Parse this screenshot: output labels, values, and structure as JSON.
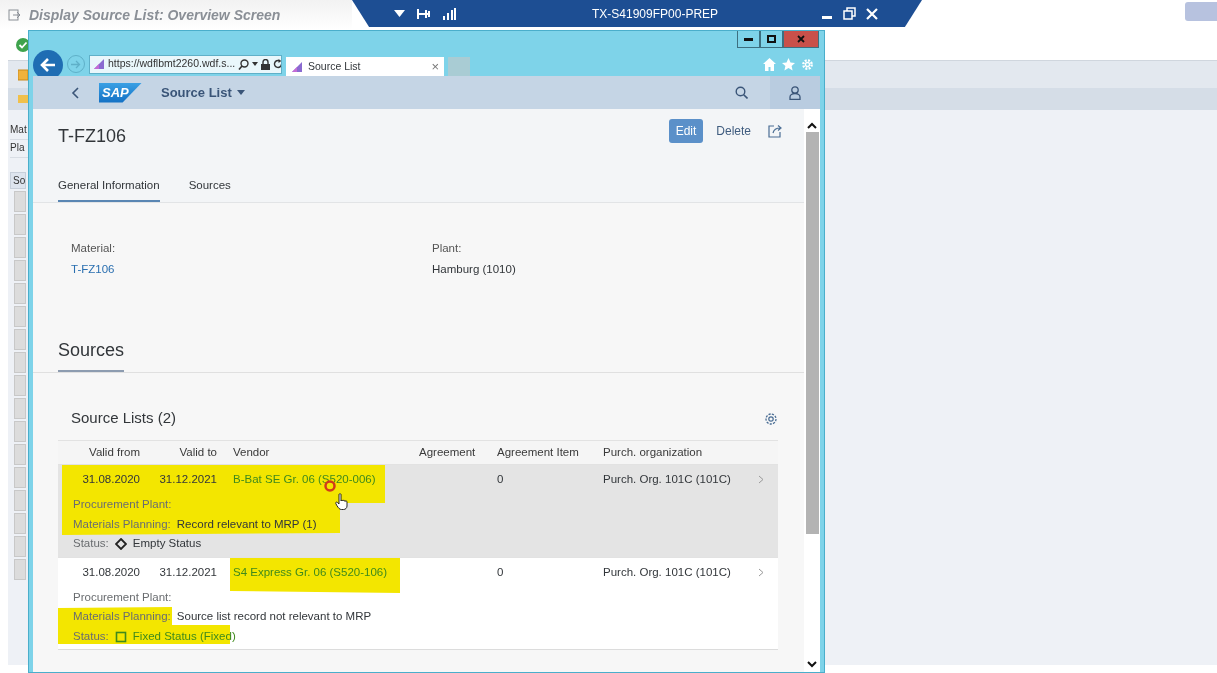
{
  "background_app": {
    "title": "Display Source List: Overview Screen",
    "connection": "TX-S41909FP00-PREP",
    "field_labels": [
      "Mat",
      "Pla"
    ],
    "tab_label": "So"
  },
  "browser": {
    "address": "https://wdflbmt2260.wdf.s...",
    "tab_title": "Source List",
    "tab_close": "×"
  },
  "shell": {
    "logo": "SAP",
    "app_title": "Source List"
  },
  "object": {
    "title": "T-FZ106",
    "actions": [
      {
        "label": "Edit",
        "kind": "primary"
      },
      {
        "label": "Delete",
        "kind": "text"
      }
    ]
  },
  "tabs": [
    {
      "label": "General Information",
      "selected": true
    },
    {
      "label": "Sources",
      "selected": false
    }
  ],
  "general_information": {
    "fields": [
      {
        "label": "Material:",
        "value": "T-FZ106",
        "kind": "link"
      },
      {
        "label": "Plant:",
        "value": "Hamburg (1010)",
        "kind": "text"
      }
    ]
  },
  "section": {
    "title": "Sources"
  },
  "source_lists": {
    "title": "Source Lists (2)",
    "columns": [
      "Valid from",
      "Valid to",
      "Vendor",
      "Agreement",
      "Agreement Item",
      "Purch. organization"
    ],
    "rows": [
      {
        "valid_from": "31.08.2020",
        "valid_to": "31.12.2021",
        "vendor": "B-Bat SE Gr. 06 (S520-006)",
        "agreement_item": "0",
        "purch_org": "Purch. Org. 101C (101C)",
        "procurement_plant_label": "Procurement Plant:",
        "materials_planning_label": "Materials Planning:",
        "materials_planning": "Record relevant to MRP (1)",
        "status_label": "Status:",
        "status": {
          "text": "Empty Status",
          "kind": "empty"
        },
        "hovered": true
      },
      {
        "valid_from": "31.08.2020",
        "valid_to": "31.12.2021",
        "vendor": "S4 Express Gr. 06 (S520-106)",
        "agreement_item": "0",
        "purch_org": "Purch. Org. 101C (101C)",
        "procurement_plant_label": "Procurement Plant:",
        "materials_planning_label": "Materials Planning:",
        "materials_planning": "Source list record not relevant to MRP",
        "status_label": "Status:",
        "status": {
          "text": "Fixed Status (Fixed)",
          "kind": "fixed"
        },
        "hovered": false
      }
    ]
  }
}
